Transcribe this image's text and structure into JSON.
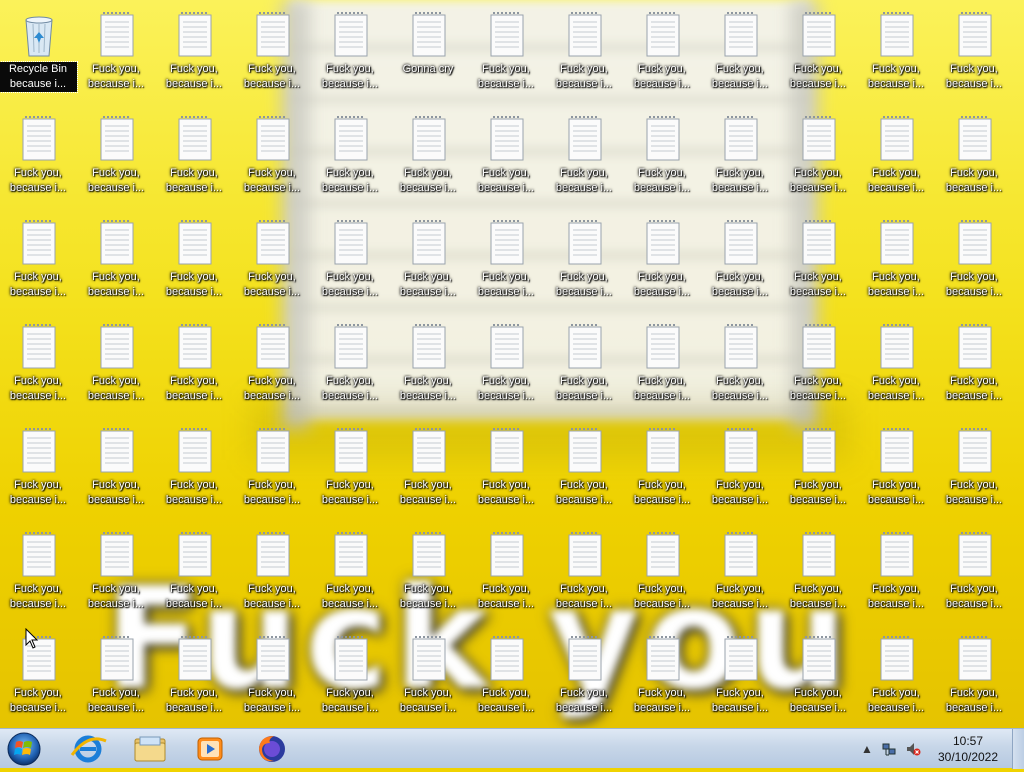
{
  "desktop": {
    "background_text": "Fuck you",
    "icons": [
      {
        "label": "Recycle Bin because i...",
        "type": "recycle-bin",
        "selected": true
      },
      {
        "label": "Fuck you, because i...",
        "type": "text-file"
      },
      {
        "label": "Fuck you, because i...",
        "type": "text-file"
      },
      {
        "label": "Fuck you, because i...",
        "type": "text-file"
      },
      {
        "label": "Fuck you, because i...",
        "type": "text-file"
      },
      {
        "label": "Gonna cry",
        "type": "text-file"
      },
      {
        "label": "Fuck you, because i...",
        "type": "text-file"
      },
      {
        "label": "Fuck you, because i...",
        "type": "text-file"
      },
      {
        "label": "Fuck you, because i...",
        "type": "text-file"
      },
      {
        "label": "Fuck you, because i...",
        "type": "text-file"
      },
      {
        "label": "Fuck you, because i...",
        "type": "text-file"
      },
      {
        "label": "Fuck you, because i...",
        "type": "text-file"
      },
      {
        "label": "Fuck you, because i...",
        "type": "text-file"
      },
      {
        "label": "Fuck you, because i...",
        "type": "text-file"
      },
      {
        "label": "Fuck you, because i...",
        "type": "text-file"
      },
      {
        "label": "Fuck you, because i...",
        "type": "text-file"
      },
      {
        "label": "Fuck you, because i...",
        "type": "text-file"
      },
      {
        "label": "Fuck you, because i...",
        "type": "text-file"
      },
      {
        "label": "Fuck you, because i...",
        "type": "text-file"
      },
      {
        "label": "Fuck you, because i...",
        "type": "text-file"
      },
      {
        "label": "Fuck you, because i...",
        "type": "text-file"
      },
      {
        "label": "Fuck you, because i...",
        "type": "text-file"
      },
      {
        "label": "Fuck you, because i...",
        "type": "text-file"
      },
      {
        "label": "Fuck you, because i...",
        "type": "text-file"
      },
      {
        "label": "Fuck you, because i...",
        "type": "text-file"
      },
      {
        "label": "Fuck you, because i...",
        "type": "text-file"
      },
      {
        "label": "Fuck you, because i...",
        "type": "text-file"
      },
      {
        "label": "Fuck you, because i...",
        "type": "text-file"
      },
      {
        "label": "Fuck you, because i...",
        "type": "text-file"
      },
      {
        "label": "Fuck you, because i...",
        "type": "text-file"
      },
      {
        "label": "Fuck you, because i...",
        "type": "text-file"
      },
      {
        "label": "Fuck you, because i...",
        "type": "text-file"
      },
      {
        "label": "Fuck you, because i...",
        "type": "text-file"
      },
      {
        "label": "Fuck you, because i...",
        "type": "text-file"
      },
      {
        "label": "Fuck you, because i...",
        "type": "text-file"
      },
      {
        "label": "Fuck you, because i...",
        "type": "text-file"
      },
      {
        "label": "Fuck you, because i...",
        "type": "text-file"
      },
      {
        "label": "Fuck you, because i...",
        "type": "text-file"
      },
      {
        "label": "Fuck you, because i...",
        "type": "text-file"
      },
      {
        "label": "Fuck you, because i...",
        "type": "text-file"
      },
      {
        "label": "Fuck you, because i...",
        "type": "text-file"
      },
      {
        "label": "Fuck you, because i...",
        "type": "text-file"
      },
      {
        "label": "Fuck you, because i...",
        "type": "text-file"
      },
      {
        "label": "Fuck you, because i...",
        "type": "text-file"
      },
      {
        "label": "Fuck you, because i...",
        "type": "text-file"
      },
      {
        "label": "Fuck you, because i...",
        "type": "text-file"
      },
      {
        "label": "Fuck you, because i...",
        "type": "text-file"
      },
      {
        "label": "Fuck you, because i...",
        "type": "text-file"
      },
      {
        "label": "Fuck you, because i...",
        "type": "text-file"
      },
      {
        "label": "Fuck you, because i...",
        "type": "text-file"
      },
      {
        "label": "Fuck you, because i...",
        "type": "text-file"
      },
      {
        "label": "Fuck you, because i...",
        "type": "text-file"
      },
      {
        "label": "Fuck you, because i...",
        "type": "text-file"
      },
      {
        "label": "Fuck you, because i...",
        "type": "text-file"
      },
      {
        "label": "Fuck you, because i...",
        "type": "text-file"
      },
      {
        "label": "Fuck you, because i...",
        "type": "text-file"
      },
      {
        "label": "Fuck you, because i...",
        "type": "text-file"
      },
      {
        "label": "Fuck you, because i...",
        "type": "text-file"
      },
      {
        "label": "Fuck you, because i...",
        "type": "text-file"
      },
      {
        "label": "Fuck you, because i...",
        "type": "text-file"
      },
      {
        "label": "Fuck you, because i...",
        "type": "text-file"
      },
      {
        "label": "Fuck you, because i...",
        "type": "text-file"
      },
      {
        "label": "Fuck you, because i...",
        "type": "text-file"
      },
      {
        "label": "Fuck you, because i...",
        "type": "text-file"
      },
      {
        "label": "Fuck you, because i...",
        "type": "text-file"
      },
      {
        "label": "Fuck you, because i...",
        "type": "text-file"
      },
      {
        "label": "Fuck you, because i...",
        "type": "text-file"
      },
      {
        "label": "Fuck you, because i...",
        "type": "text-file"
      },
      {
        "label": "Fuck you, because i...",
        "type": "text-file"
      },
      {
        "label": "Fuck you, because i...",
        "type": "text-file"
      },
      {
        "label": "Fuck you, because i...",
        "type": "text-file"
      },
      {
        "label": "Fuck you, because i...",
        "type": "text-file"
      },
      {
        "label": "Fuck you, because i...",
        "type": "text-file"
      },
      {
        "label": "Fuck you, because i...",
        "type": "text-file"
      },
      {
        "label": "Fuck you, because i...",
        "type": "text-file"
      },
      {
        "label": "Fuck you, because i...",
        "type": "text-file"
      },
      {
        "label": "Fuck you, because i...",
        "type": "text-file"
      },
      {
        "label": "Fuck you, because i...",
        "type": "text-file"
      },
      {
        "label": "Fuck you, because i...",
        "type": "text-file"
      },
      {
        "label": "Fuck you, because i...",
        "type": "text-file"
      },
      {
        "label": "Fuck you, because i...",
        "type": "text-file"
      },
      {
        "label": "Fuck you, because i...",
        "type": "text-file"
      },
      {
        "label": "Fuck you, because i...",
        "type": "text-file"
      },
      {
        "label": "Fuck you, because i...",
        "type": "text-file"
      },
      {
        "label": "Fuck you, because i...",
        "type": "text-file"
      },
      {
        "label": "Fuck you, because i...",
        "type": "text-file"
      },
      {
        "label": "Fuck you, because i...",
        "type": "text-file"
      },
      {
        "label": "Fuck you, because i...",
        "type": "text-file"
      },
      {
        "label": "Fuck you, because i...",
        "type": "text-file"
      },
      {
        "label": "Fuck you, because i...",
        "type": "text-file"
      },
      {
        "label": "Fuck you, because i...",
        "type": "text-file"
      }
    ]
  },
  "taskbar": {
    "start_icon": "windows-start-orb-icon",
    "pinned": [
      {
        "name": "internet-explorer-icon"
      },
      {
        "name": "file-explorer-icon"
      },
      {
        "name": "media-player-icon"
      },
      {
        "name": "firefox-icon"
      }
    ],
    "tray": {
      "show_hidden_icon": "up-arrow-icon",
      "network_icon": "network-icon",
      "volume_icon": "volume-muted-icon"
    },
    "clock": {
      "time": "10:57",
      "date": "30/10/2022"
    }
  },
  "colors": {
    "wallpaper_yellow": "#f0d300",
    "taskbar": "#c7d6e8"
  }
}
